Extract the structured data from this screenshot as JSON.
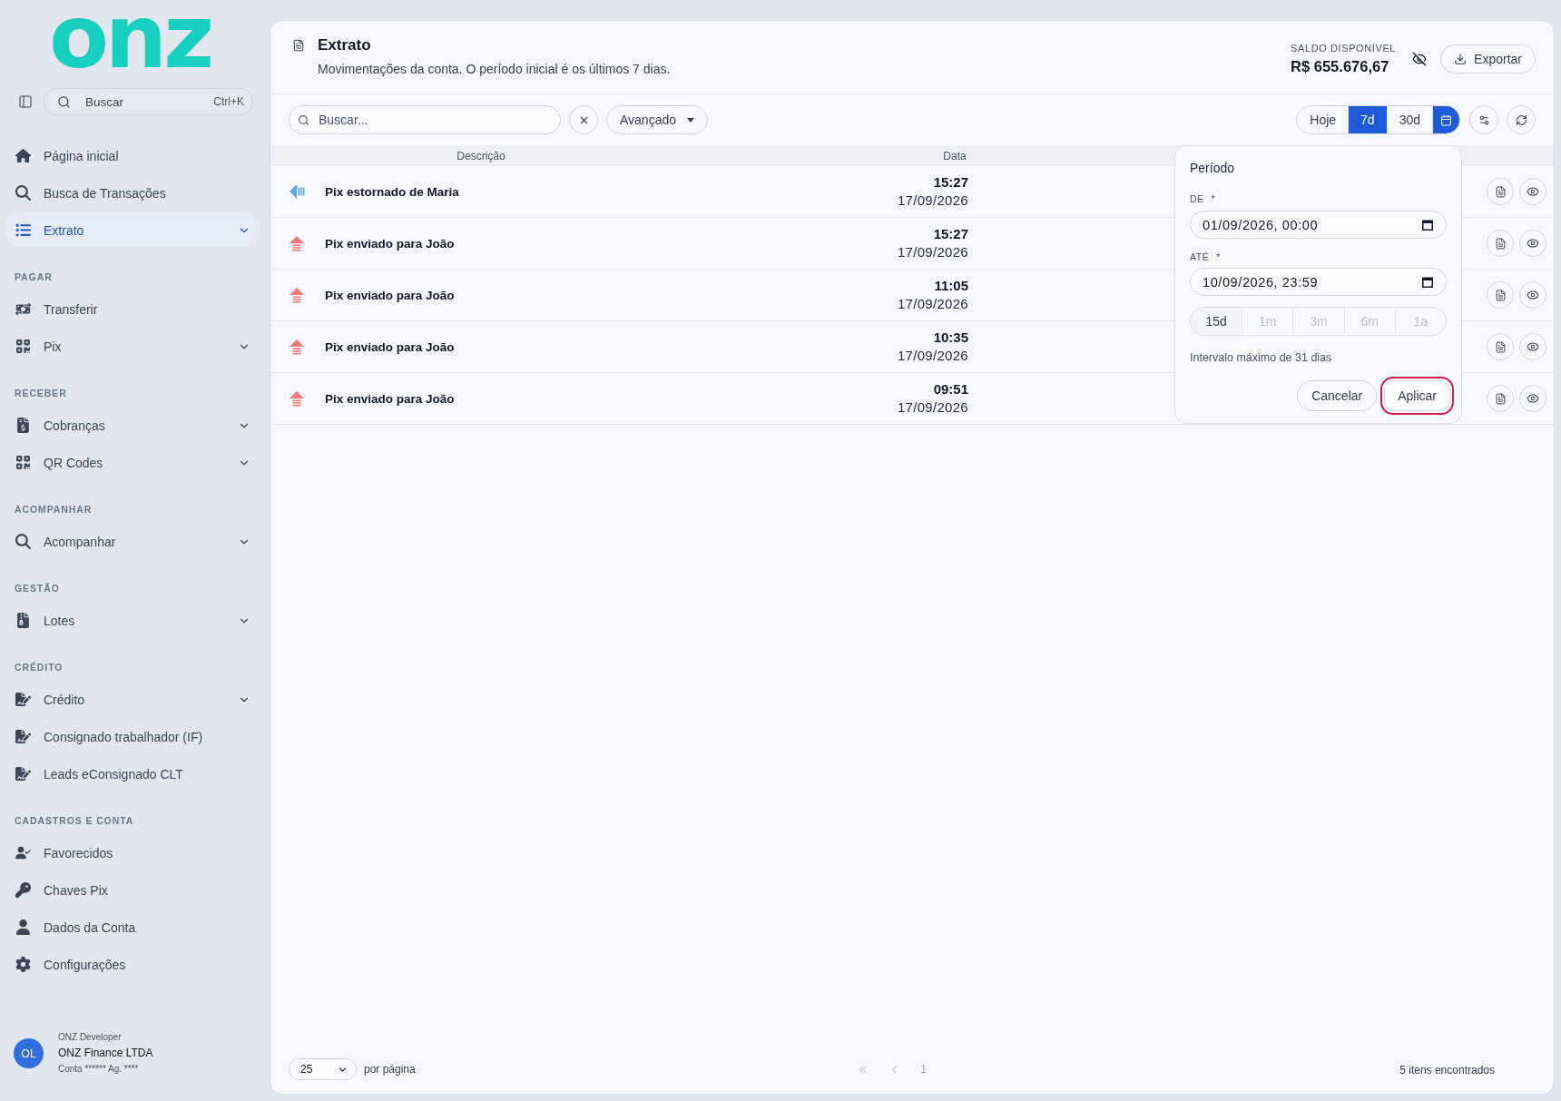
{
  "sidebar": {
    "logo": "onz",
    "search": {
      "placeholder": "Buscar",
      "shortcut": "Ctrl+K"
    },
    "sections": [
      {
        "items": [
          {
            "label": "Página inicial",
            "selected": false,
            "has_submenu": false
          },
          {
            "label": "Busca de Transações",
            "selected": false,
            "has_submenu": false
          },
          {
            "label": "Extrato",
            "selected": true,
            "has_submenu": true
          }
        ]
      },
      {
        "heading": "PAGAR",
        "items": [
          {
            "label": "Transferir",
            "selected": false,
            "has_submenu": false
          },
          {
            "label": "Pix",
            "selected": false,
            "has_submenu": true
          }
        ]
      },
      {
        "heading": "RECEBER",
        "items": [
          {
            "label": "Cobranças",
            "selected": false,
            "has_submenu": true
          },
          {
            "label": "QR Codes",
            "selected": false,
            "has_submenu": true
          }
        ]
      },
      {
        "heading": "ACOMPANHAR",
        "items": [
          {
            "label": "Acompanhar",
            "selected": false,
            "has_submenu": true
          }
        ]
      },
      {
        "heading": "GESTÃO",
        "items": [
          {
            "label": "Lotes",
            "selected": false,
            "has_submenu": true
          }
        ]
      },
      {
        "heading": "CRÉDITO",
        "items": [
          {
            "label": "Crédito",
            "selected": false,
            "has_submenu": true
          },
          {
            "label": "Consignado trabalhador (IF)",
            "selected": false,
            "has_submenu": false
          },
          {
            "label": "Leads eConsignado CLT",
            "selected": false,
            "has_submenu": false
          }
        ]
      },
      {
        "heading": "CADASTROS E CONTA",
        "items": [
          {
            "label": "Favorecidos",
            "selected": false,
            "has_submenu": false
          },
          {
            "label": "Chaves Pix",
            "selected": false,
            "has_submenu": false
          },
          {
            "label": "Dados da Conta",
            "selected": false,
            "has_submenu": false
          },
          {
            "label": "Configurações",
            "selected": false,
            "has_submenu": false
          }
        ]
      }
    ],
    "user": {
      "initials": "OL",
      "role": "ONZ Developer",
      "company": "ONZ Finance LTDA",
      "account": "Conta ****** Ag. ****"
    }
  },
  "header": {
    "title": "Extrato",
    "subtitle": "Movimentações da conta. O período inicial é os últimos 7 dias.",
    "balance_label": "SALDO DISPONÍVEL",
    "balance": "R$ 655.676,67",
    "export_button": "Exportar"
  },
  "toolbar": {
    "search": {
      "placeholder": "Buscar..."
    },
    "advanced_button": "Avançado",
    "range_tabs": [
      {
        "kind": "text",
        "label": "Hoje",
        "selected": false
      },
      {
        "kind": "text",
        "label": "7d",
        "selected": true
      },
      {
        "kind": "text",
        "label": "30d",
        "selected": false
      },
      {
        "kind": "calendar",
        "selected": true
      }
    ]
  },
  "table": {
    "columns": [
      "Descrição",
      "Data"
    ],
    "rows": [
      {
        "kind": "reversal",
        "description": "Pix estornado de Maria",
        "time": "15:27",
        "date": "17/09/2026"
      },
      {
        "kind": "sent",
        "description": "Pix enviado para João",
        "time": "15:27",
        "date": "17/09/2026"
      },
      {
        "kind": "sent",
        "description": "Pix enviado para João",
        "time": "11:05",
        "date": "17/09/2026"
      },
      {
        "kind": "sent",
        "description": "Pix enviado para João",
        "time": "10:35",
        "date": "17/09/2026"
      },
      {
        "kind": "sent",
        "description": "Pix enviado para João",
        "time": "09:51",
        "date": "17/09/2026"
      }
    ]
  },
  "period_popover": {
    "title": "Período",
    "from": {
      "label": "DE",
      "required_mark": "*",
      "value": "01/09/2026, 00:00"
    },
    "to": {
      "label": "ATÉ",
      "required_mark": "*",
      "value": "10/09/2026, 23:59"
    },
    "presets": [
      {
        "label": "15d",
        "disabled": false
      },
      {
        "label": "1m",
        "disabled": true
      },
      {
        "label": "3m",
        "disabled": true
      },
      {
        "label": "6m",
        "disabled": true
      },
      {
        "label": "1a",
        "disabled": true
      }
    ],
    "hint": "Intervalo máximo de 31 dias",
    "cancel_button": "Cancelar",
    "apply_button": {
      "label": "Aplicar",
      "focused": true
    }
  },
  "footer": {
    "page_size": "25",
    "page_size_label": "por página",
    "current_page": "1",
    "count": "5 itens encontrados"
  }
}
